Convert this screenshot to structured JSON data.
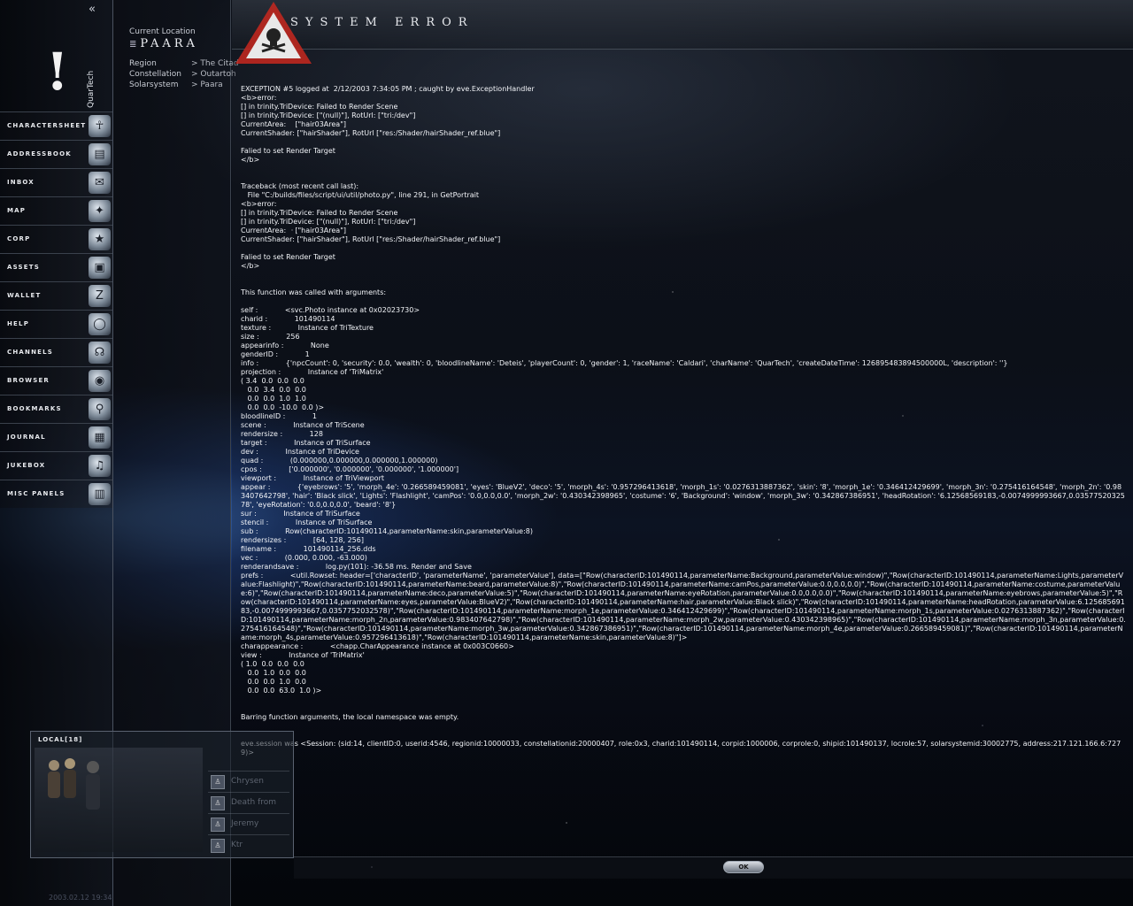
{
  "sidebar": {
    "collapse_glyph": "«",
    "portrait_glyph": "!",
    "character_name": "QuarTech",
    "items": [
      {
        "label": "CHARACTERSHEET",
        "icon": "charactersheet-icon",
        "glyph": "☥"
      },
      {
        "label": "ADDRESSBOOK",
        "icon": "addressbook-icon",
        "glyph": "▤"
      },
      {
        "label": "INBOX",
        "icon": "inbox-icon",
        "glyph": "✉"
      },
      {
        "label": "MAP",
        "icon": "map-icon",
        "glyph": "✦"
      },
      {
        "label": "CORP",
        "icon": "corp-icon",
        "glyph": "★"
      },
      {
        "label": "ASSETS",
        "icon": "assets-icon",
        "glyph": "▣"
      },
      {
        "label": "WALLET",
        "icon": "wallet-icon",
        "glyph": "Z"
      },
      {
        "label": "HELP",
        "icon": "help-icon",
        "glyph": "◯"
      },
      {
        "label": "CHANNELS",
        "icon": "channels-icon",
        "glyph": "☊"
      },
      {
        "label": "BROWSER",
        "icon": "browser-icon",
        "glyph": "◉"
      },
      {
        "label": "BOOKMARKS",
        "icon": "bookmarks-icon",
        "glyph": "⚲"
      },
      {
        "label": "JOURNAL",
        "icon": "journal-icon",
        "glyph": "▦"
      },
      {
        "label": "JUKEBOX",
        "icon": "jukebox-icon",
        "glyph": "♫"
      },
      {
        "label": "MISC PANELS",
        "icon": "misc-panels-icon",
        "glyph": "▥"
      }
    ]
  },
  "location": {
    "header": "Current Location",
    "name": "PAARA",
    "region_label": "Region",
    "region_value": "> The Citad",
    "constellation_label": "Constellation",
    "constellation_value": "> Outartoh",
    "solarsystem_label": "Solarsystem",
    "solarsystem_value": "> Paara"
  },
  "local_chat": {
    "title": "LOCAL[18]",
    "members": [
      {
        "name": "Chrysen"
      },
      {
        "name": "Death from"
      },
      {
        "name": "Jeremy"
      },
      {
        "name": "Ktr"
      }
    ],
    "timestamp": "2003.02.12 19:34"
  },
  "error_window": {
    "title": "SYSTEM ERROR",
    "warning_icon": "skull-warning-icon",
    "ok_label": "OK",
    "text": "EXCEPTION #5 logged at  2/12/2003 7:34:05 PM ; caught by eve.ExceptionHandler\n<b>error:\n[] in trinity.TriDevice: Failed to Render Scene\n[] in trinity.TriDevice: [\"(null)\"], RotUrl: [\"tri:/dev\"]\nCurrentArea:    [\"hair03Area\"]\nCurrentShader: [\"hairShader\"], RotUrl [\"res:/Shader/hairShader_ref.blue\"]\n\nFalied to set Render Target\n</b>\n\n\nTraceback (most recent call last):\n   File \"C:/builds/files/script/ui/util/photo.py\", line 291, in GetPortrait\n<b>error:\n[] in trinity.TriDevice: Failed to Render Scene\n[] in trinity.TriDevice: [\"(null)\"], RotUrl: [\"tri:/dev\"]\nCurrentArea:    [\"hair03Area\"]\nCurrentShader: [\"hairShader\"], RotUrl [\"res:/Shader/hairShader_ref.blue\"]\n\nFalied to set Render Target\n</b>\n\n\nThis function was called with arguments:\n\nself :            <svc.Photo instance at 0x02023730>\ncharid :            101490114\ntexture :            Instance of TriTexture\nsize :            256\nappearinfo :            None\ngenderID :            1\ninfo :            {'npcCount': 0, 'security': 0.0, 'wealth': 0, 'bloodlineName': 'Deteis', 'playerCount': 0, 'gender': 1, 'raceName': 'Caldari', 'charName': 'QuarTech', 'createDateTime': 126895483894500000L, 'description': ''}\nprojection :            Instance of 'TriMatrix'\n( 3.4  0.0  0.0  0.0\n   0.0  3.4  0.0  0.0\n   0.0  0.0  1.0  1.0\n   0.0  0.0  -10.0  0.0 )>\nbloodlineID :            1\nscene :            Instance of TriScene\nrendersize :            128\ntarget :            Instance of TriSurface\ndev :            Instance of TriDevice\nquad :            (0.000000,0.000000,0.000000,1.000000)\ncpos :            ['0.000000', '0.000000', '0.000000', '1.000000']\nviewport :            Instance of TriViewport\nappear :            {'eyebrows': '5', 'morph_4e': '0.266589459081', 'eyes': 'BlueV2', 'deco': '5', 'morph_4s': '0.957296413618', 'morph_1s': '0.0276313887362', 'skin': '8', 'morph_1e': '0.346412429699', 'morph_3n': '0.275416164548', 'morph_2n': '0.983407642798', 'hair': 'Black slick', 'Lights': 'Flashlight', 'camPos': '0.0,0.0,0.0', 'morph_2w': '0.430342398965', 'costume': '6', 'Background': 'window', 'morph_3w': '0.342867386951', 'headRotation': '6.12568569183,-0.0074999993667,0.0357752032578', 'eyeRotation': '0.0,0.0,0.0', 'beard': '8'}\nsur :            Instance of TriSurface\nstencil :            Instance of TriSurface\nsub :            Row(characterID:101490114,parameterName:skin,parameterValue:8)\nrendersizes :            [64, 128, 256]\nfilename :            101490114_256.dds\nvec :            (0.000, 0.000, -63.000)\nrenderandsave :            log.py(101): -36.58 ms. Render and Save\nprefs :            <util.Rowset: header=['characterID', 'parameterName', 'parameterValue'], data=[\"Row(characterID:101490114,parameterName:Background,parameterValue:window)\",\"Row(characterID:101490114,parameterName:Lights,parameterValue:Flashlight)\",\"Row(characterID:101490114,parameterName:beard,parameterValue:8)\",\"Row(characterID:101490114,parameterName:camPos,parameterValue:0.0,0.0,0.0)\",\"Row(characterID:101490114,parameterName:costume,parameterValue:6)\",\"Row(characterID:101490114,parameterName:deco,parameterValue:5)\",\"Row(characterID:101490114,parameterName:eyeRotation,parameterValue:0.0,0.0,0.0)\",\"Row(characterID:101490114,parameterName:eyebrows,parameterValue:5)\",\"Row(characterID:101490114,parameterName:eyes,parameterValue:BlueV2)\",\"Row(characterID:101490114,parameterName:hair,parameterValue:Black slick)\",\"Row(characterID:101490114,parameterName:headRotation,parameterValue:6.12568569183,-0.0074999993667,0.0357752032578)\",\"Row(characterID:101490114,parameterName:morph_1e,parameterValue:0.346412429699)\",\"Row(characterID:101490114,parameterName:morph_1s,parameterValue:0.0276313887362)\",\"Row(characterID:101490114,parameterName:morph_2n,parameterValue:0.983407642798)\",\"Row(characterID:101490114,parameterName:morph_2w,parameterValue:0.430342398965)\",\"Row(characterID:101490114,parameterName:morph_3n,parameterValue:0.275416164548)\",\"Row(characterID:101490114,parameterName:morph_3w,parameterValue:0.342867386951)\",\"Row(characterID:101490114,parameterName:morph_4e,parameterValue:0.266589459081)\",\"Row(characterID:101490114,parameterName:morph_4s,parameterValue:0.957296413618)\",\"Row(characterID:101490114,parameterName:skin,parameterValue:8)\"]>\ncharappearance :            <chapp.CharAppearance instance at 0x003C0660>\nview :            Instance of 'TriMatrix'\n( 1.0  0.0  0.0  0.0\n   0.0  1.0  0.0  0.0\n   0.0  0.0  1.0  0.0\n   0.0  0.0  63.0  1.0 )>\n\n\nBarring function arguments, the local namespace was empty.\n\n\neve.session was <Session: (sid:14, clientID:0, userid:4546, regionid:10000033, constellationid:20000407, role:0x3, charid:101490114, corpid:1000006, corprole:0, shipid:101490137, locrole:57, solarsystemid:30002775, address:217.121.166.6:7279)>"
  }
}
